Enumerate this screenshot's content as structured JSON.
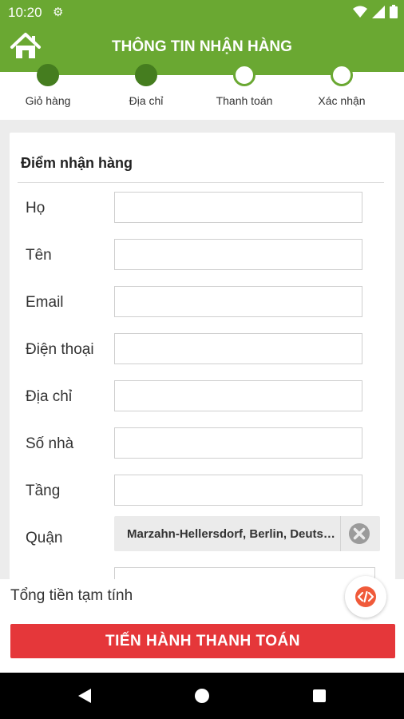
{
  "status_bar": {
    "time": "10:20"
  },
  "header": {
    "title": "THÔNG TIN NHẬN HÀNG"
  },
  "steps": [
    {
      "label": "Giỏ hàng",
      "state": "done"
    },
    {
      "label": "Địa chỉ",
      "state": "done"
    },
    {
      "label": "Thanh toán",
      "state": "pending"
    },
    {
      "label": "Xác nhận",
      "state": "pending"
    }
  ],
  "form": {
    "section_title": "Điểm nhận hàng",
    "fields": [
      {
        "label": "Họ",
        "value": ""
      },
      {
        "label": "Tên",
        "value": ""
      },
      {
        "label": "Email",
        "value": ""
      },
      {
        "label": "Điện thoại",
        "value": ""
      },
      {
        "label": "Địa chỉ",
        "value": ""
      },
      {
        "label": "Số nhà",
        "value": ""
      },
      {
        "label": "Tầng",
        "value": ""
      }
    ],
    "district": {
      "label": "Quận",
      "value": "Marzahn-Hellersdorf, Berlin, Deutschland"
    }
  },
  "bottom": {
    "subtotal_label": "Tổng tiền tạm tính",
    "checkout_label": "TIẾN HÀNH THANH TOÁN"
  },
  "colors": {
    "primary": "#6aa832",
    "step_done": "#457d1f",
    "checkout": "#e5373a",
    "fab": "#f05a3a"
  },
  "icons": [
    "settings-icon",
    "wifi-icon",
    "signal-icon",
    "battery-icon",
    "home-icon",
    "clear-icon",
    "code-icon",
    "back-icon",
    "home-nav-icon",
    "recents-icon"
  ]
}
